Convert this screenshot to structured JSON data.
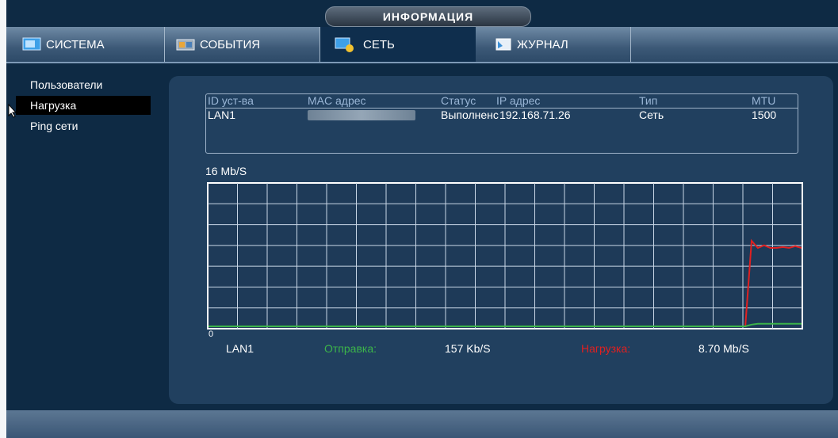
{
  "header": {
    "title": "ИНФОРМАЦИЯ"
  },
  "tabs": [
    {
      "label": "СИСТЕМА",
      "icon": "system-icon"
    },
    {
      "label": "СОБЫТИЯ",
      "icon": "events-icon"
    },
    {
      "label": "СЕТЬ",
      "icon": "network-icon",
      "active": true
    },
    {
      "label": "ЖУРНАЛ",
      "icon": "journal-icon"
    }
  ],
  "sidebar": {
    "items": [
      {
        "label": "Пользователи"
      },
      {
        "label": "Нагрузка",
        "active": true
      },
      {
        "label": "Ping сети"
      }
    ]
  },
  "table": {
    "headers": {
      "id": "ID уст-ва",
      "mac": "MAC адрес",
      "status": "Статус",
      "ip": "IP адрес",
      "type": "Тип",
      "mtu": "MTU"
    },
    "rows": [
      {
        "id": "LAN1",
        "mac": "",
        "status": "Выполненс",
        "ip": "192.168.71.26",
        "type": "Сеть",
        "mtu": "1500"
      }
    ]
  },
  "chart_data": {
    "type": "line",
    "title": "",
    "scale_label": "16 Mb/S",
    "zero_label": "0",
    "ylim": [
      0,
      16
    ],
    "xlabel": "",
    "ylabel": "",
    "grid": true,
    "series": [
      {
        "name": "Нагрузка",
        "color": "#e02020",
        "values": [
          0,
          0,
          0,
          0,
          0,
          0,
          0,
          0,
          0,
          0,
          0,
          0,
          0,
          0,
          0,
          0,
          0,
          0,
          0,
          0,
          0,
          0,
          0,
          0,
          0,
          0,
          0,
          0,
          0,
          0,
          0,
          0,
          0,
          0,
          0,
          0,
          0,
          0,
          0,
          0,
          0,
          0,
          0,
          0,
          0,
          0,
          0,
          0,
          0,
          0,
          0,
          0,
          0,
          0,
          0,
          0,
          0,
          0,
          0,
          0,
          0,
          0,
          0,
          0,
          0,
          0,
          0,
          0,
          0,
          0,
          0,
          0,
          0,
          0,
          0,
          0,
          0,
          0,
          0,
          0,
          0,
          0,
          0,
          0,
          0,
          0,
          0,
          9.7,
          8.9,
          9.2,
          8.9,
          8.9,
          9.0,
          8.9,
          9.1,
          8.9
        ]
      },
      {
        "name": "Отправка",
        "color": "#3cb44a",
        "values": [
          0,
          0,
          0,
          0,
          0,
          0,
          0,
          0,
          0,
          0,
          0,
          0,
          0,
          0,
          0,
          0,
          0,
          0,
          0,
          0,
          0,
          0,
          0,
          0,
          0,
          0,
          0,
          0,
          0,
          0,
          0,
          0,
          0,
          0,
          0,
          0,
          0,
          0,
          0,
          0,
          0,
          0,
          0,
          0,
          0,
          0,
          0,
          0,
          0,
          0,
          0,
          0,
          0,
          0,
          0,
          0,
          0,
          0,
          0,
          0,
          0,
          0,
          0,
          0,
          0,
          0,
          0,
          0,
          0,
          0,
          0,
          0,
          0,
          0,
          0,
          0,
          0,
          0,
          0,
          0,
          0,
          0,
          0,
          0,
          0,
          0,
          0,
          0.2,
          0.3,
          0.3,
          0.3,
          0.3,
          0.3,
          0.3,
          0.3,
          0.3
        ]
      }
    ]
  },
  "stats": {
    "iface": "LAN1",
    "send_label": "Отправка:",
    "send_value": "157 Kb/S",
    "load_label": "Нагрузка:",
    "load_value": "8.70 Mb/S",
    "send_color": "#3cb44a",
    "load_color": "#e02020"
  }
}
